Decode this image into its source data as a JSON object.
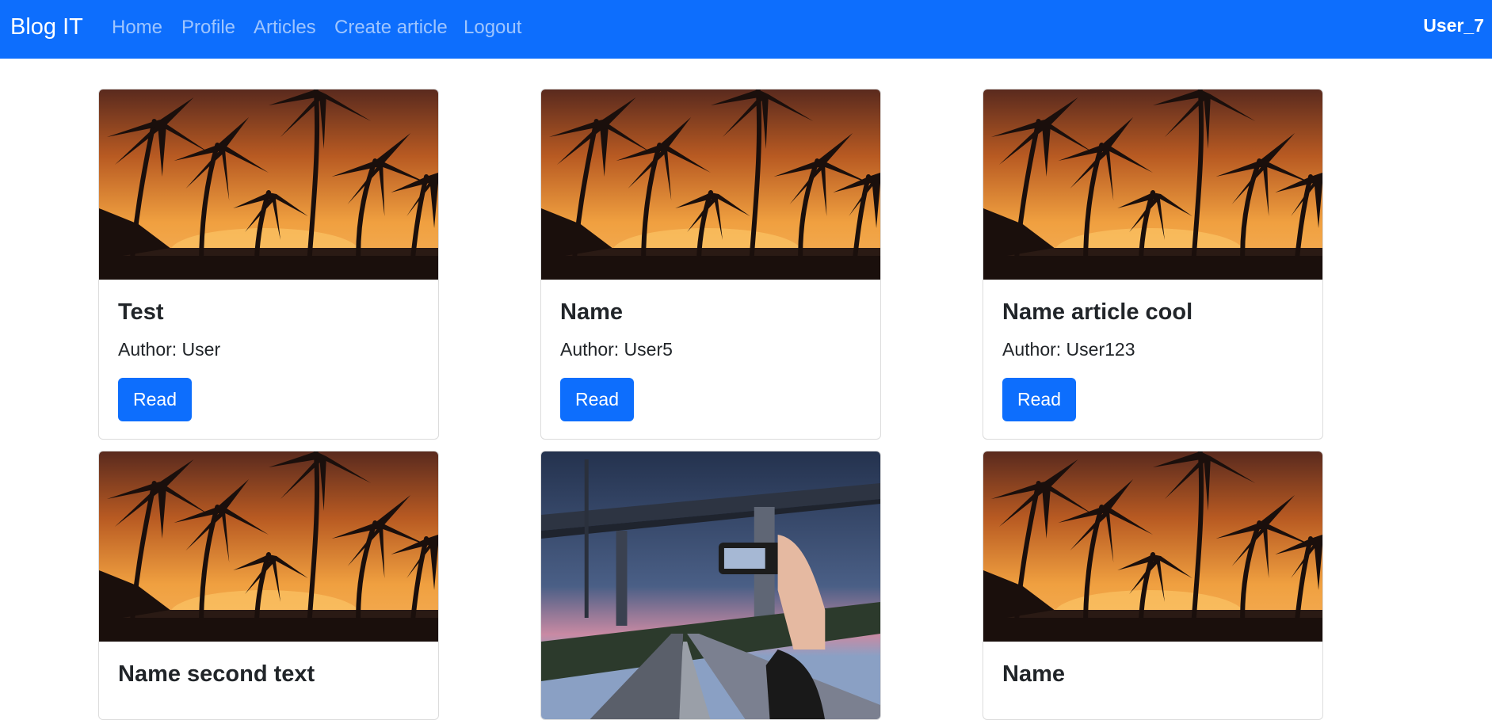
{
  "navbar": {
    "brand": "Blog IT",
    "links": [
      "Home",
      "Profile",
      "Articles",
      "Create article",
      "Logout"
    ],
    "user": "User_7"
  },
  "articles": [
    {
      "title": "Test",
      "author": "Author: User",
      "button": "Read",
      "image": "palm-trees-sunset-image"
    },
    {
      "title": "Name",
      "author": "Author: User5",
      "button": "Read",
      "image": "palm-trees-sunset-image"
    },
    {
      "title": "Name article cool",
      "author": "Author: User123",
      "button": "Read",
      "image": "palm-trees-sunset-image"
    },
    {
      "title": "Name second text",
      "image": "palm-trees-sunset-image"
    },
    {
      "title": "",
      "image": "road-bridge-phone-image"
    },
    {
      "title": "Name",
      "image": "palm-trees-sunset-image"
    }
  ],
  "colors": {
    "primary": "#0d6efd",
    "text": "#212529"
  }
}
